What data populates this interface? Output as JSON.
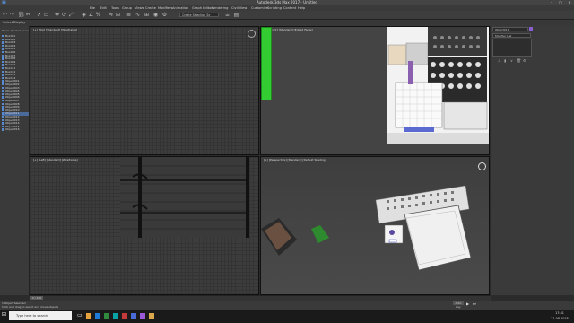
{
  "title": "Autodesk 3ds Max 2017 - Untitled",
  "workspace": "Workspace: Default",
  "menus": [
    "File",
    "Edit",
    "Tools",
    "Group",
    "Views",
    "Create",
    "Modifiers",
    "Animation",
    "Graph Editors",
    "Rendering",
    "Civil View",
    "Customize",
    "Scripting",
    "Content",
    "Help"
  ],
  "selection_set": "Create Selection Se",
  "tabs": [
    "Select",
    "Display"
  ],
  "scene_explorer": {
    "header": "Name (Sorted Ascendi",
    "items": [
      "Box001",
      "Box002",
      "Box003",
      "Box004",
      "Box005",
      "Box006",
      "Box007",
      "Box008",
      "Box009",
      "Box010",
      "Box011",
      "Box012",
      "Box013",
      "Box014",
      "Object001",
      "Object002",
      "Object003",
      "Object004",
      "Object005",
      "Object006",
      "Object007",
      "Object008",
      "Object009",
      "Object010",
      "Object011",
      "Object012",
      "Object013",
      "Object014",
      "Object015",
      "Object016"
    ]
  },
  "viewports": {
    "top": "[+] [Top] [Standard] [Wireframe]",
    "front": "[+] [Front] [Standard] [Edged Faces]",
    "left": "[+] [Left] [Standard] [Wireframe]",
    "perspective": "[+] [Perspective] [Standard] [Default Shading]"
  },
  "command_panel": {
    "name_field": "Object011",
    "modifier_list": "Modifier List"
  },
  "timeline": {
    "frame": "0 / 100"
  },
  "status": {
    "line1": "1 Object Selected",
    "line2": "Click and drag to select and move objects",
    "autokey": "Auto Key"
  },
  "taskbar": {
    "search_placeholder": "Type here to search",
    "time": "17:41",
    "date": "21.08.2018"
  },
  "colors": {
    "accent_green": "#33cc33",
    "selection_blue": "#5a8ad0"
  }
}
